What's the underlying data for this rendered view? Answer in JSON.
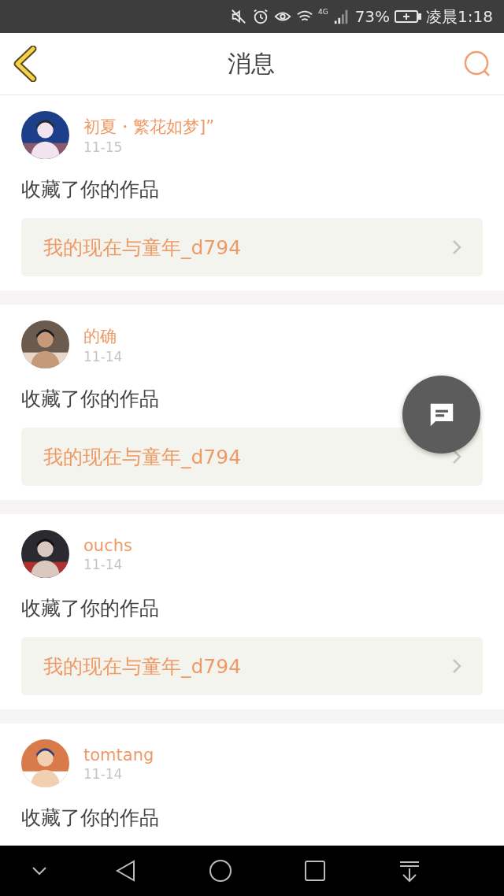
{
  "status_bar": {
    "network": "4G",
    "battery": "73%",
    "time": "凌晨1:18"
  },
  "header": {
    "title": "消息"
  },
  "messages": [
    {
      "user": "初夏・繁花如梦]”",
      "date": "11-15",
      "text": "收藏了你的作品",
      "work": "我的现在与童年_d794"
    },
    {
      "user": "的确",
      "date": "11-14",
      "text": "收藏了你的作品",
      "work": "我的现在与童年_d794"
    },
    {
      "user": "ouchs",
      "date": "11-14",
      "text": "收藏了你的作品",
      "work": "我的现在与童年_d794"
    },
    {
      "user": "tomtang",
      "date": "11-14",
      "text": "收藏了你的作品"
    }
  ]
}
